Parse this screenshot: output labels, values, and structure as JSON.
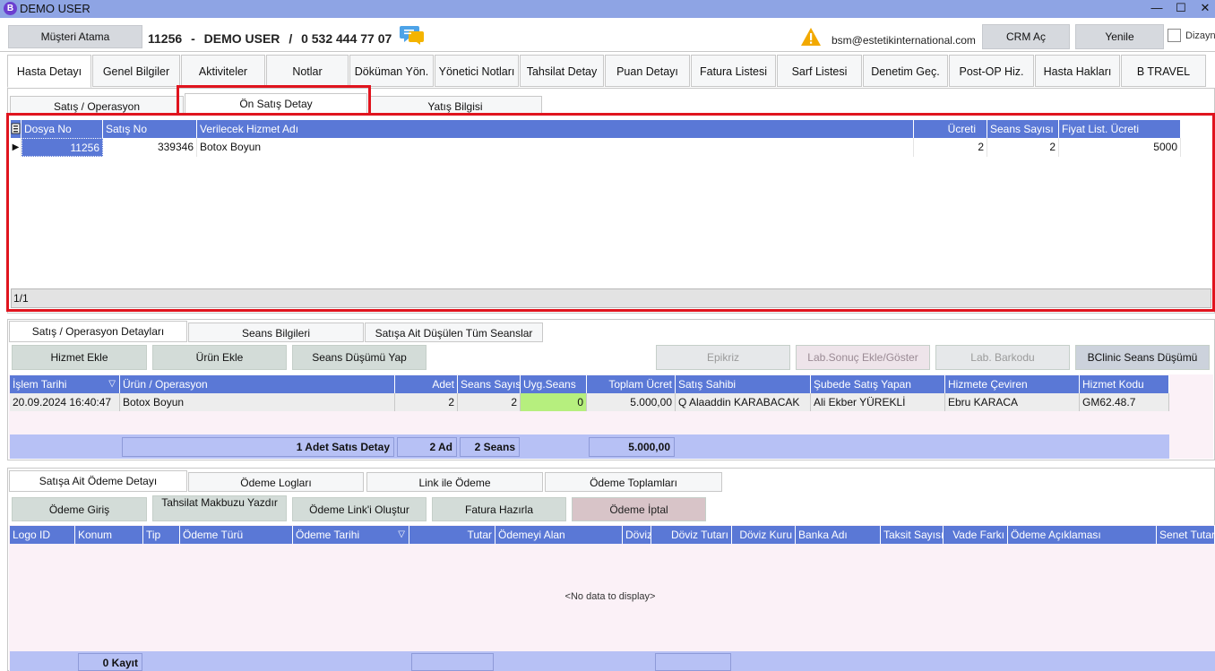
{
  "window": {
    "title": "DEMO USER",
    "logo_letter": "B",
    "minimize": "—",
    "maximize": "☐",
    "close": "✕"
  },
  "header": {
    "assign_button": "Müşteri Atama",
    "file_no": "11256",
    "sep1": "-",
    "patient_name": "DEMO USER",
    "sep2": "/",
    "phone": "0 532 444 77 07",
    "email": "bsm@estetikinternational.com",
    "crm_button": "CRM Aç",
    "refresh_button": "Yenile",
    "design_label": "Dizayn",
    "design_checked": false
  },
  "top_tabs": [
    {
      "label": "Hasta Detayı",
      "active": true
    },
    {
      "label": "Genel Bilgiler"
    },
    {
      "label": "Aktiviteler"
    },
    {
      "label": "Notlar"
    },
    {
      "label": "Döküman Yön."
    },
    {
      "label": "Yönetici Notları"
    },
    {
      "label": "Tahsilat Detay"
    },
    {
      "label": "Puan Detayı"
    },
    {
      "label": "Fatura Listesi"
    },
    {
      "label": "Sarf Listesi"
    },
    {
      "label": "Denetim Geç."
    },
    {
      "label": "Post-OP Hiz."
    },
    {
      "label": "Hasta Hakları"
    },
    {
      "label": "B TRAVEL"
    }
  ],
  "sales_tabs": [
    {
      "label": "Satış / Operasyon"
    },
    {
      "label": "Ön Satış Detay",
      "active": true
    },
    {
      "label": "Yatış Bilgisi"
    }
  ],
  "presale_grid": {
    "columns": [
      "Dosya No",
      "Satış No",
      "Verilecek Hizmet Adı",
      "Ücreti",
      "Seans Sayısı",
      "Fiyat List. Ücreti"
    ],
    "rows": [
      {
        "file_no": "11256",
        "sale_no": "339346",
        "service": "Botox Boyun",
        "fee": "2",
        "sessions": "2",
        "list_price": "5000"
      }
    ],
    "pager": "1/1"
  },
  "detail_tabs": [
    {
      "label": "Satış / Operasyon Detayları",
      "active": true
    },
    {
      "label": "Seans Bilgileri"
    },
    {
      "label": "Satışa Ait Düşülen Tüm Seanslar"
    }
  ],
  "detail_actions": {
    "add_service": "Hizmet Ekle",
    "add_product": "Ürün Ekle",
    "session_deduct": "Seans Düşümü Yap",
    "epicrisis": "Epikriz",
    "lab_result": "Lab.Sonuç Ekle/Göster",
    "lab_barcode": "Lab. Barkodu",
    "bclinic": "BClinic Seans Düşümü"
  },
  "detail_grid": {
    "columns": [
      "İşlem Tarihi",
      "Ürün / Operasyon",
      "Adet",
      "Seans Sayısı",
      "Uyg.Seans",
      "Toplam Ücret",
      "Satış Sahibi",
      "Şubede Satış Yapan",
      "Hizmete Çeviren",
      "Hizmet Kodu"
    ],
    "rows": [
      {
        "date": "20.09.2024 16:40:47",
        "product": "Botox Boyun",
        "qty": "2",
        "sessions": "2",
        "applied": "0",
        "total": "5.000,00",
        "owner": "Q Alaaddin KARABACAK",
        "branch_seller": "Ali Ekber YÜREKLİ",
        "converter": "Ebru KARACA",
        "code": "GM62.48.7"
      }
    ],
    "summary": {
      "count": "1 Adet Satıs Detay",
      "qty": "2 Ad",
      "sessions": "2 Seans",
      "total": "5.000,00"
    }
  },
  "payment_tabs": [
    {
      "label": "Satışa Ait Ödeme Detayı",
      "active": true
    },
    {
      "label": "Ödeme Logları"
    },
    {
      "label": "Link ile Ödeme"
    },
    {
      "label": "Ödeme Toplamları"
    }
  ],
  "payment_actions": {
    "entry": "Ödeme Giriş",
    "receipt": "Tahsilat Makbuzu Yazdır",
    "create_link": "Ödeme Link'i Oluştur",
    "invoice": "Fatura Hazırla",
    "cancel": "Ödeme İptal"
  },
  "payment_grid": {
    "columns": [
      "Logo ID",
      "Konum",
      "Tip",
      "Ödeme Türü",
      "Ödeme Tarihi",
      "Tutar",
      "Ödemeyi Alan",
      "Döviz",
      "Döviz Tutarı",
      "Döviz Kuru",
      "Banka Adı",
      "Taksit Sayısı",
      "Vade Farkı",
      "Ödeme Açıklaması",
      "Senet Tutarı"
    ],
    "empty_text": "<No data to display>",
    "footer_count": "0 Kayıt"
  },
  "colors": {
    "title_bar": "#8ea4e4",
    "grid_header": "#5a78d6",
    "highlight_red": "#e0141e",
    "summary_bar": "#b7c1f5",
    "applied_cell": "#b6ef7e"
  }
}
